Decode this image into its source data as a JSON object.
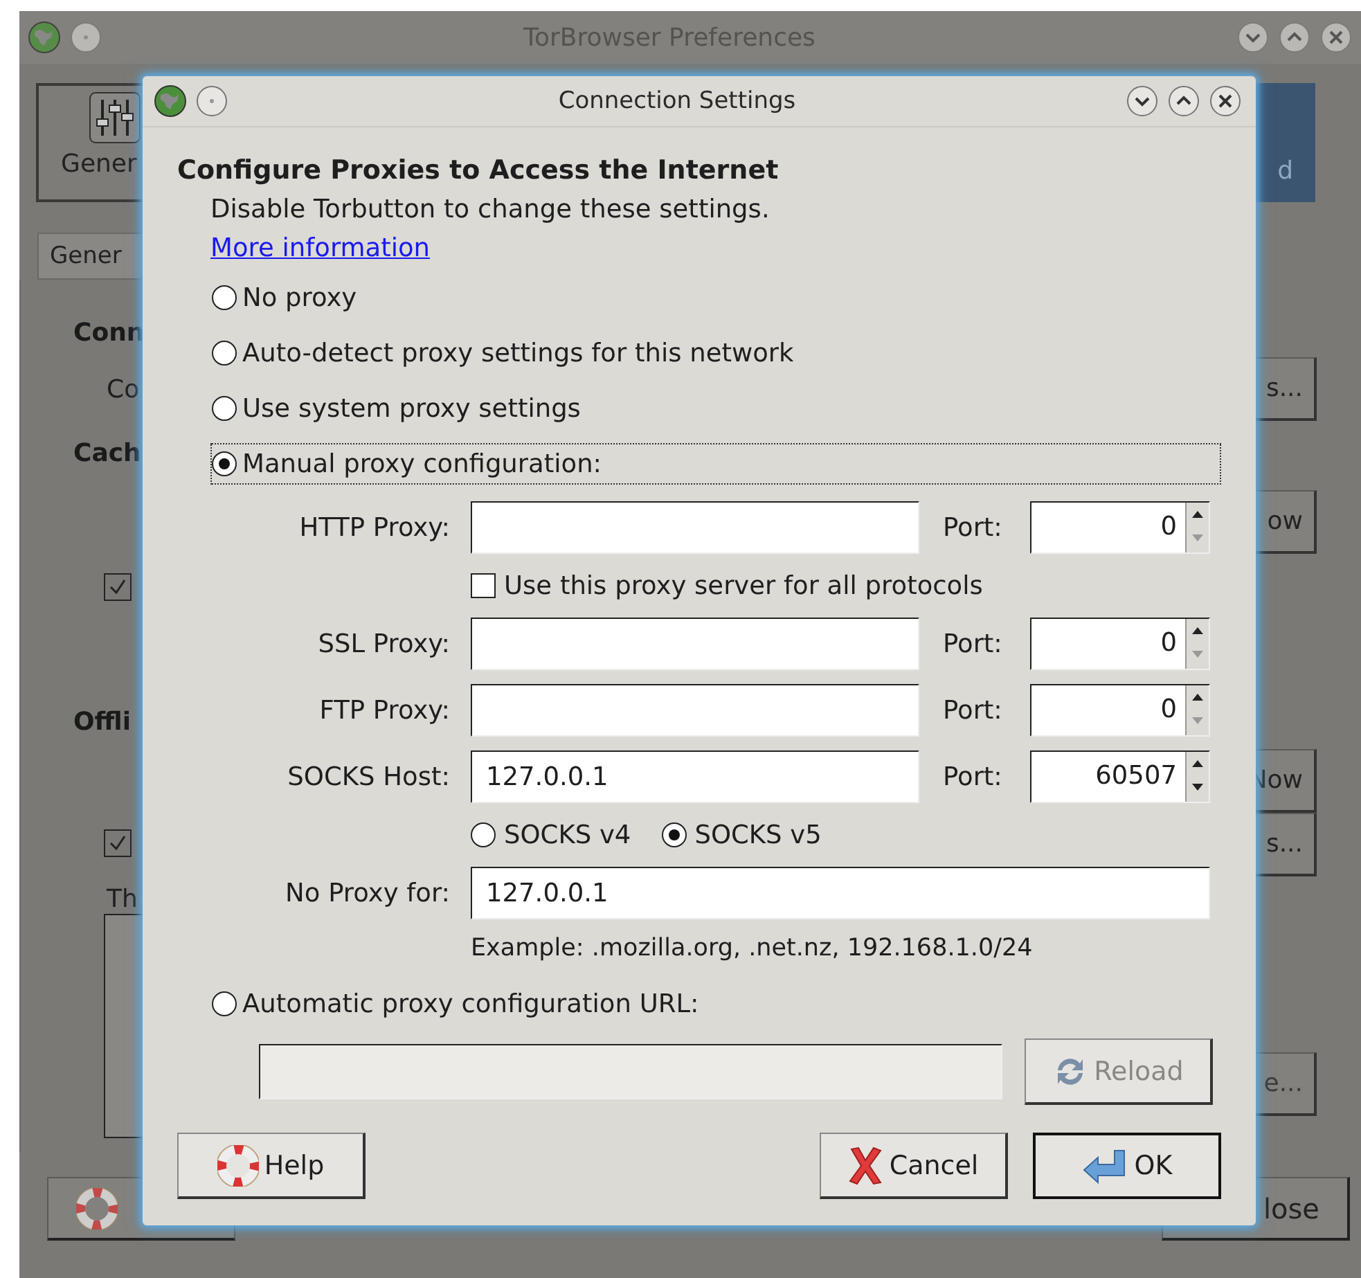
{
  "parent_window": {
    "title": "TorBrowser Preferences",
    "toolbar": [
      {
        "label": "Gener",
        "selected": false
      },
      {
        "label": "d",
        "selected": true
      }
    ],
    "tabs": [
      {
        "label": "Gener",
        "selected": true
      }
    ],
    "rows": [
      {
        "kind": "heading",
        "text": "Conn"
      },
      {
        "kind": "text",
        "text": "Co",
        "button": "s..."
      },
      {
        "kind": "heading",
        "text": "Cach"
      },
      {
        "kind": "empty",
        "button": "ow"
      },
      {
        "kind": "checkbox",
        "checked": true
      },
      {
        "kind": "heading",
        "text": "Offli"
      },
      {
        "kind": "empty",
        "button": "Now"
      },
      {
        "kind": "checkbox",
        "checked": true,
        "button": "s..."
      },
      {
        "kind": "text",
        "text": "Th"
      },
      {
        "kind": "list",
        "button": "e..."
      }
    ],
    "close_button": "lose"
  },
  "dialog": {
    "title": "Connection Settings",
    "heading": "Configure Proxies to Access the Internet",
    "note": "Disable Torbutton to change these settings.",
    "link": "More information",
    "proxy_options": [
      {
        "label": "No proxy",
        "selected": false
      },
      {
        "label": "Auto-detect proxy settings for this network",
        "selected": false
      },
      {
        "label": "Use system proxy settings",
        "selected": false
      },
      {
        "label": "Manual proxy configuration:",
        "selected": true
      }
    ],
    "proxies": [
      {
        "label": "HTTP Proxy:",
        "port_label": "Port:",
        "port": "0",
        "down_disabled": true
      },
      {
        "label": "SSL Proxy:",
        "port_label": "Port:",
        "port": "0",
        "down_disabled": true
      },
      {
        "label": "FTP Proxy:",
        "port_label": "Port:",
        "port": "0",
        "down_disabled": true
      },
      {
        "label": "SOCKS Host:",
        "value": "127.0.0.1",
        "port_label": "Port:",
        "port": "60507",
        "down_disabled": false
      }
    ],
    "use_for_all": {
      "label": "Use this proxy server for all protocols",
      "checked": false
    },
    "socks_versions": [
      {
        "label": "SOCKS v4",
        "selected": false
      },
      {
        "label": "SOCKS v5",
        "selected": true
      }
    ],
    "no_proxy": {
      "label": "No Proxy for:",
      "value": "127.0.0.1"
    },
    "example": "Example: .mozilla.org, .net.nz, 192.168.1.0/24",
    "auto_config": {
      "label": "Automatic proxy configuration URL:",
      "selected": false,
      "reload": "Reload",
      "reload_disabled": true
    },
    "buttons": {
      "help": "Help",
      "cancel": "Cancel",
      "ok": "OK"
    }
  }
}
